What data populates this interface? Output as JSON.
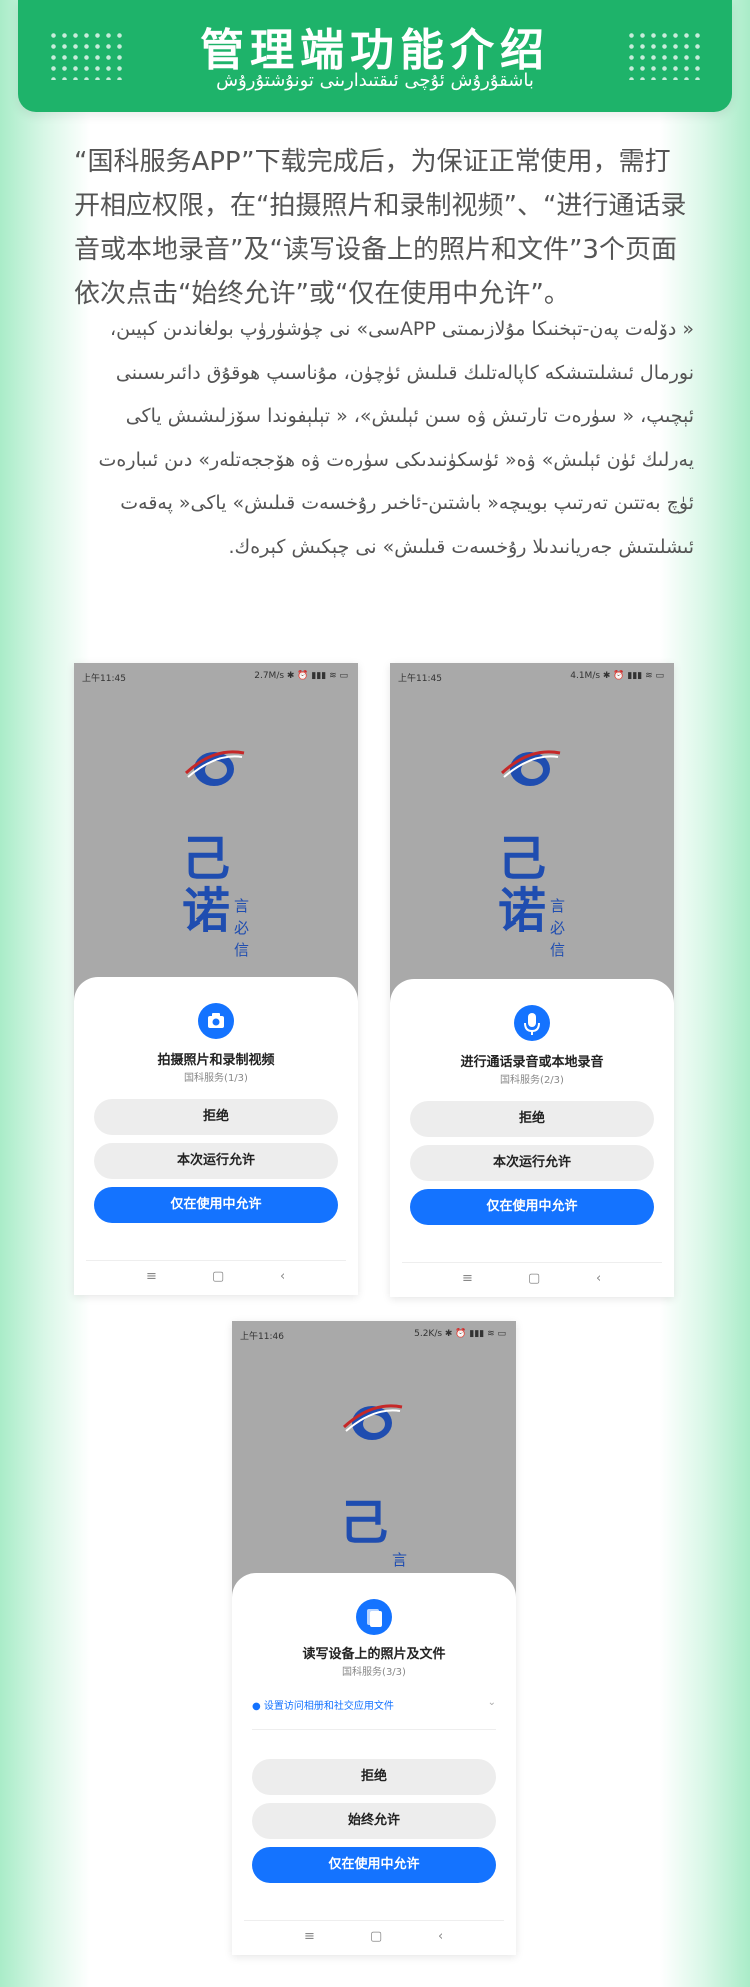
{
  "header": {
    "title": "管理端功能介绍",
    "subtitle": "باشقۇرۇش ئۇچى ئىقتىدارىنى تونۇشتۇرۇش"
  },
  "intro": {
    "zh": "“国科服务APP”下载完成后，为保证正常使用，需打开相应权限，在“拍摄照片和录制视频”、“进行通话录音或本地录音”及“读写设备上的照片和文件”3个页面依次点击“始终允许”或“仅在使用中允许”。",
    "ug": "« دۆلەت پەن-تېخنىكا مۇلازىمىتى APPسى» نى چۈشۈرۈپ بولغاندىن كېيىن، نورمال ئىشلىتىشكە كاپالەتلىك قىلىش ئۈچۈن، مۇناسىپ ھوقۇق دائىرىسىنى ئېچىپ، « سۈرەت تارتىش ۋە سىن ئېلىش»، « تېلېفوندا سۆزلىشىش ياكى يەرلىك ئۈن ئېلىش» ۋە« ئۈسكۈنىدىكى سۈرەت ۋە ھۆججەتلەر» دىن ئىبارەت ئۈچ بەتتىن تەرتىپ بويىچە« باشتىن-ئاخىر رۇخسەت قىلىش» ياكى« پەقەت ئىشلىتىش جەريانىدىلا رۇخسەت قىلىش» نى چېكىش كېرەك."
  },
  "screens": [
    {
      "time": "上午11:45",
      "status": "2.7M/s ✱ ⏰ ▮▮▮ ≋ ▭",
      "brand": "己诺",
      "brand_side": "言必信",
      "icon": "camera-icon",
      "title": "拍摄照片和录制视频",
      "subtitle": "国科服务(1/3)",
      "buttons": [
        "拒绝",
        "本次运行允许",
        "仅在使用中允许"
      ]
    },
    {
      "time": "上午11:45",
      "status": "4.1M/s ✱ ⏰ ▮▮▮ ≋ ▭",
      "brand": "己诺",
      "brand_side": "言必信",
      "icon": "microphone-icon",
      "title": "进行通话录音或本地录音",
      "subtitle": "国科服务(2/3)",
      "buttons": [
        "拒绝",
        "本次运行允许",
        "仅在使用中允许"
      ]
    },
    {
      "time": "上午11:46",
      "status": "5.2K/s ✱ ⏰ ▮▮▮ ≋ ▭",
      "brand": "己",
      "brand_side": "言",
      "icon": "files-icon",
      "title": "读写设备上的照片及文件",
      "subtitle": "国科服务(3/3)",
      "hint": "设置访问相册和社交应用文件",
      "buttons": [
        "拒绝",
        "始终允许",
        "仅在使用中允许"
      ]
    }
  ],
  "navbar": [
    "≡",
    "▢",
    "‹"
  ],
  "colors": {
    "header_green": "#1eb36a",
    "primary_blue": "#1473ff",
    "brand_blue": "#1f4db0"
  }
}
